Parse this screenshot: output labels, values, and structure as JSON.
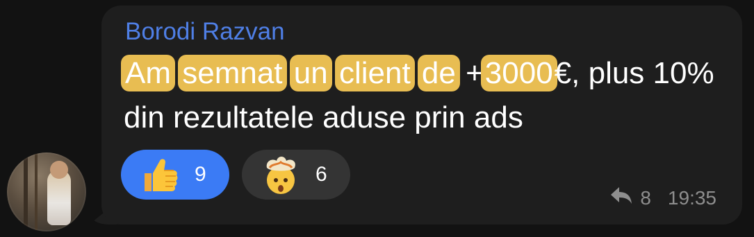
{
  "message": {
    "sender": "Borodi Razvan",
    "text_segments": [
      {
        "text": "Am",
        "highlight": true
      },
      {
        "text": " ",
        "highlight": false
      },
      {
        "text": "semnat",
        "highlight": true
      },
      {
        "text": " ",
        "highlight": false
      },
      {
        "text": "un",
        "highlight": true
      },
      {
        "text": " ",
        "highlight": false
      },
      {
        "text": "client",
        "highlight": true
      },
      {
        "text": " ",
        "highlight": false
      },
      {
        "text": "de",
        "highlight": true
      },
      {
        "text": " +",
        "highlight": false
      },
      {
        "text": "3000",
        "highlight": true
      },
      {
        "text": "€, plus 10% din rezultatele aduse prin ads",
        "highlight": false
      }
    ],
    "reactions": [
      {
        "emoji": "thumbs-up-icon",
        "count": "9",
        "active": true
      },
      {
        "emoji": "exploding-head-icon",
        "count": "6",
        "active": false
      }
    ],
    "replies_count": "8",
    "time": "19:35"
  },
  "colors": {
    "sender": "#4f7fe6",
    "highlight": "#e8bd52",
    "active_reaction": "#3b7bf5",
    "inactive_reaction": "#343434",
    "bubble": "#1e1e1e"
  }
}
